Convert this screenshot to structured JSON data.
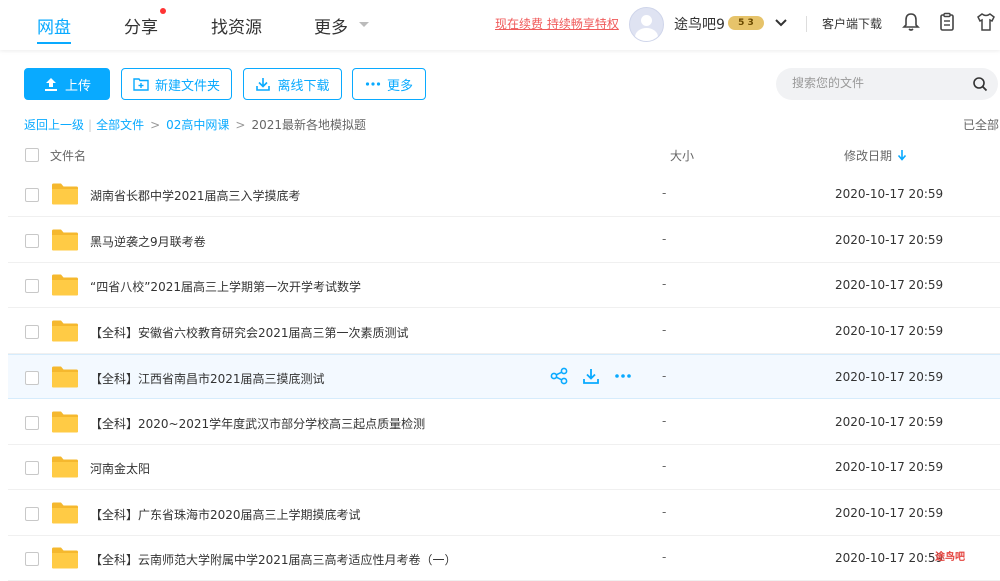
{
  "nav": {
    "tabs": [
      {
        "label": "网盘"
      },
      {
        "label": "分享"
      },
      {
        "label": "找资源"
      },
      {
        "label": "更多"
      }
    ],
    "promo": "现在续费 持续畅享特权",
    "username": "途鸟吧9",
    "vip_badge": "5 3",
    "client_download": "客户端下载"
  },
  "toolbar": {
    "upload": "上传",
    "new_folder": "新建文件夹",
    "offline_download": "离线下载",
    "more": "更多",
    "search_placeholder": "搜索您的文件"
  },
  "breadcrumb": {
    "back": "返回上一级",
    "all_files": "全部文件",
    "folder": "02高中网课",
    "current": "2021最新各地模拟题",
    "loaded": "已全部"
  },
  "table": {
    "col_name": "文件名",
    "col_size": "大小",
    "col_date": "修改日期",
    "rows": [
      {
        "name": "湖南省长郡中学2021届高三入学摸底考",
        "size": "-",
        "date": "2020-10-17 20:59"
      },
      {
        "name": "黑马逆袭之9月联考卷",
        "size": "-",
        "date": "2020-10-17 20:59"
      },
      {
        "name": "“四省八校”2021届高三上学期第一次开学考试数学",
        "size": "-",
        "date": "2020-10-17 20:59"
      },
      {
        "name": "【全科】安徽省六校教育研究会2021届高三第一次素质测试",
        "size": "-",
        "date": "2020-10-17 20:59"
      },
      {
        "name": "【全科】江西省南昌市2021届高三摸底测试",
        "size": "-",
        "date": "2020-10-17 20:59"
      },
      {
        "name": "【全科】2020~2021学年度武汉市部分学校高三起点质量检测",
        "size": "-",
        "date": "2020-10-17 20:59"
      },
      {
        "name": "河南金太阳",
        "size": "-",
        "date": "2020-10-17 20:59"
      },
      {
        "name": "【全科】广东省珠海市2020届高三上学期摸底考试",
        "size": "-",
        "date": "2020-10-17 20:59"
      },
      {
        "name": "【全科】云南师范大学附属中学2021届高三高考适应性月考卷（一）",
        "size": "-",
        "date": "2020-10-17 20:59"
      }
    ]
  },
  "watermark": "途鸟吧",
  "colors": {
    "accent": "#09aaff",
    "folder": "#ffc83d",
    "promo": "#f05a5a"
  }
}
